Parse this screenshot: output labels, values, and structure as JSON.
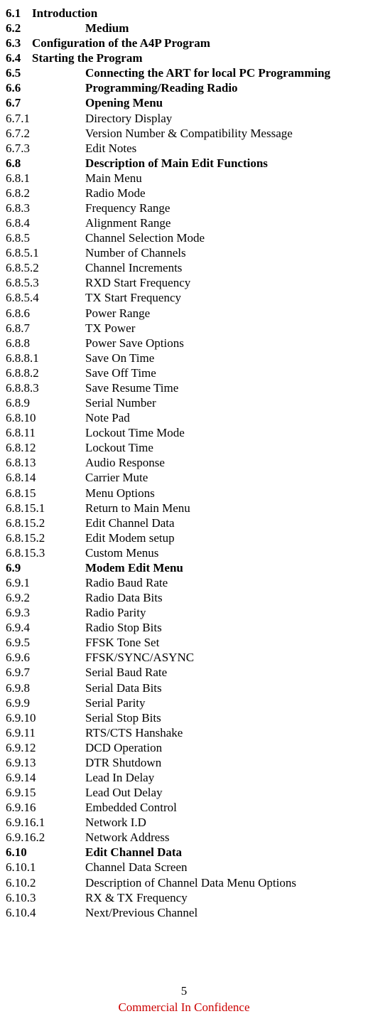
{
  "footer": {
    "page_number": "5",
    "confidentiality": "Commercial In Confidence"
  },
  "toc": [
    {
      "num": "6.1",
      "title": "Introduction",
      "bold": true,
      "shortnum": true
    },
    {
      "num": "6.2",
      "title": "Medium",
      "bold": true,
      "shortnum": false
    },
    {
      "num": "6.3",
      "title": "Configuration of the A4P Program",
      "bold": true,
      "shortnum": true
    },
    {
      "num": "6.4",
      "title": "Starting the Program",
      "bold": true,
      "shortnum": true
    },
    {
      "num": "6.5",
      "title": "Connecting the ART for local PC Programming",
      "bold": true,
      "shortnum": false
    },
    {
      "num": "6.6",
      "title": "Programming/Reading Radio",
      "bold": true,
      "shortnum": false
    },
    {
      "num": "6.7",
      "title": "Opening Menu",
      "bold": true,
      "shortnum": false
    },
    {
      "num": "6.7.1",
      "title": "Directory Display",
      "bold": false,
      "shortnum": false
    },
    {
      "num": "6.7.2",
      "title": "Version Number & Compatibility Message",
      "bold": false,
      "shortnum": false
    },
    {
      "num": "6.7.3",
      "title": "Edit Notes",
      "bold": false,
      "shortnum": false
    },
    {
      "num": "6.8",
      "title": "Description of Main Edit Functions",
      "bold": true,
      "shortnum": false
    },
    {
      "num": "6.8.1",
      "title": "Main Menu",
      "bold": false,
      "shortnum": false
    },
    {
      "num": "6.8.2",
      "title": "Radio Mode",
      "bold": false,
      "shortnum": false
    },
    {
      "num": "6.8.3",
      "title": "Frequency Range",
      "bold": false,
      "shortnum": false
    },
    {
      "num": "6.8.4",
      "title": "Alignment Range",
      "bold": false,
      "shortnum": false
    },
    {
      "num": "6.8.5",
      "title": "Channel Selection Mode",
      "bold": false,
      "shortnum": false
    },
    {
      "num": "6.8.5.1",
      "title": "Number of Channels",
      "bold": false,
      "shortnum": false
    },
    {
      "num": "6.8.5.2",
      "title": "Channel Increments",
      "bold": false,
      "shortnum": false
    },
    {
      "num": "6.8.5.3",
      "title": "RXD Start Frequency",
      "bold": false,
      "shortnum": false
    },
    {
      "num": "6.8.5.4",
      "title": "TX Start Frequency",
      "bold": false,
      "shortnum": false
    },
    {
      "num": "6.8.6",
      "title": "Power Range",
      "bold": false,
      "shortnum": false
    },
    {
      "num": "6.8.7",
      "title": "TX Power",
      "bold": false,
      "shortnum": false
    },
    {
      "num": "6.8.8",
      "title": "Power Save Options",
      "bold": false,
      "shortnum": false
    },
    {
      "num": "6.8.8.1",
      "title": "Save On Time",
      "bold": false,
      "shortnum": false
    },
    {
      "num": "6.8.8.2",
      "title": "Save Off Time",
      "bold": false,
      "shortnum": false
    },
    {
      "num": "6.8.8.3",
      "title": "Save Resume Time",
      "bold": false,
      "shortnum": false
    },
    {
      "num": "6.8.9",
      "title": "Serial Number",
      "bold": false,
      "shortnum": false
    },
    {
      "num": "6.8.10",
      "title": "Note Pad",
      "bold": false,
      "shortnum": false
    },
    {
      "num": "6.8.11",
      "title": "Lockout Time Mode",
      "bold": false,
      "shortnum": false
    },
    {
      "num": "6.8.12",
      "title": "Lockout Time",
      "bold": false,
      "shortnum": false
    },
    {
      "num": "6.8.13",
      "title": "Audio Response",
      "bold": false,
      "shortnum": false
    },
    {
      "num": "6.8.14",
      "title": "Carrier Mute",
      "bold": false,
      "shortnum": false
    },
    {
      "num": "6.8.15",
      "title": "Menu Options",
      "bold": false,
      "shortnum": false
    },
    {
      "num": "6.8.15.1",
      "title": "Return to Main Menu",
      "bold": false,
      "shortnum": false
    },
    {
      "num": "6.8.15.2",
      "title": "Edit Channel Data",
      "bold": false,
      "shortnum": false
    },
    {
      "num": "6.8.15.2",
      "title": "Edit Modem setup",
      "bold": false,
      "shortnum": false
    },
    {
      "num": "6.8.15.3",
      "title": "Custom Menus",
      "bold": false,
      "shortnum": false
    },
    {
      "num": "6.9",
      "title": "Modem Edit Menu",
      "bold": true,
      "shortnum": false
    },
    {
      "num": "6.9.1",
      "title": "Radio Baud Rate",
      "bold": false,
      "shortnum": false
    },
    {
      "num": "6.9.2",
      "title": "Radio Data Bits",
      "bold": false,
      "shortnum": false
    },
    {
      "num": "6.9.3",
      "title": "Radio Parity",
      "bold": false,
      "shortnum": false
    },
    {
      "num": "6.9.4",
      "title": "Radio Stop Bits",
      "bold": false,
      "shortnum": false
    },
    {
      "num": "6.9.5",
      "title": "FFSK Tone Set",
      "bold": false,
      "shortnum": false
    },
    {
      "num": "6.9.6",
      "title": "FFSK/SYNC/ASYNC",
      "bold": false,
      "shortnum": false
    },
    {
      "num": "6.9.7",
      "title": "Serial Baud Rate",
      "bold": false,
      "shortnum": false
    },
    {
      "num": "6.9.8",
      "title": "Serial Data Bits",
      "bold": false,
      "shortnum": false
    },
    {
      "num": "6.9.9",
      "title": "Serial Parity",
      "bold": false,
      "shortnum": false
    },
    {
      "num": "6.9.10",
      "title": "Serial Stop Bits",
      "bold": false,
      "shortnum": false
    },
    {
      "num": "6.9.11",
      "title": "RTS/CTS Hanshake",
      "bold": false,
      "shortnum": false
    },
    {
      "num": "6.9.12",
      "title": "DCD Operation",
      "bold": false,
      "shortnum": false
    },
    {
      "num": "6.9.13",
      "title": "DTR Shutdown",
      "bold": false,
      "shortnum": false
    },
    {
      "num": "6.9.14",
      "title": "Lead In Delay",
      "bold": false,
      "shortnum": false
    },
    {
      "num": "6.9.15",
      "title": "Lead Out Delay",
      "bold": false,
      "shortnum": false
    },
    {
      "num": "6.9.16",
      "title": "Embedded Control",
      "bold": false,
      "shortnum": false
    },
    {
      "num": "6.9.16.1",
      "title": "Network I.D",
      "bold": false,
      "shortnum": false
    },
    {
      "num": "6.9.16.2",
      "title": "Network Address",
      "bold": false,
      "shortnum": false
    },
    {
      "num": "6.10",
      "title": "Edit Channel Data",
      "bold": true,
      "shortnum": false
    },
    {
      "num": "6.10.1",
      "title": "Channel Data Screen",
      "bold": false,
      "shortnum": false
    },
    {
      "num": "6.10.2",
      "title": "Description of Channel Data Menu Options",
      "bold": false,
      "shortnum": false
    },
    {
      "num": "6.10.3",
      "title": "RX & TX Frequency",
      "bold": false,
      "shortnum": false
    },
    {
      "num": "6.10.4",
      "title": "Next/Previous Channel",
      "bold": false,
      "shortnum": false
    }
  ]
}
